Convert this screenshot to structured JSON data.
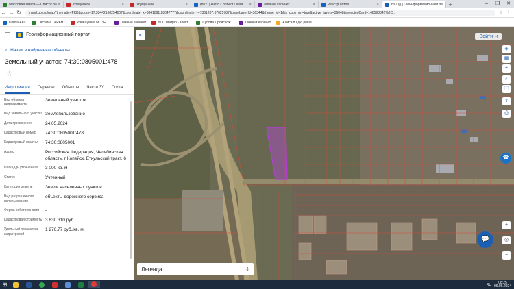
{
  "browser": {
    "tabs": [
      {
        "title": "Массовая земля — Список ра",
        "color": "#2e7d32",
        "active": false
      },
      {
        "title": "Упущенное",
        "color": "#c62828",
        "active": false
      },
      {
        "title": "Упущенное",
        "color": "#c62828",
        "active": false
      },
      {
        "title": "(8021) Retro Connect Client",
        "color": "#1565c0",
        "active": false
      },
      {
        "title": "Личный кабинет",
        "color": "#6a1b9a",
        "active": false
      },
      {
        "title": "Реестр лотов",
        "color": "#1565c0",
        "active": false
      },
      {
        "title": "НСПД | Геоинформационный п",
        "color": "#1a5fb4",
        "active": true
      }
    ],
    "url": "nspd.gov.ru/map?thematic=PKK&zoom=17.33442160254207&coordinate_x=6841891.28047777&coordinate_y=7361207.67025787&baseLayerId=36344&theme_id=1&is_copy_url=true&active_layers=36048&selectedCard=148598842%2C...",
    "bookmarks": [
      {
        "label": "Почта АКС",
        "color": "#1565c0"
      },
      {
        "label": "Система ГАРАНТ",
        "color": "#2e7d32"
      },
      {
        "label": "Извещения МОЗЕ...",
        "color": "#c62828"
      },
      {
        "label": "Личный кабинет",
        "color": "#6a1b9a"
      },
      {
        "label": "УПС гандар - злект...",
        "color": "#c62828"
      },
      {
        "label": "Сусова Происхож...",
        "color": "#2e7d32"
      },
      {
        "label": "Личный кабинет",
        "color": "#6a1b9a"
      },
      {
        "label": "Алиса Ю дю реше...",
        "color": "#f9a825"
      }
    ]
  },
  "portal": {
    "title": "Геоинформационный портал",
    "back_link": "Назад в найденные объекты",
    "parcel_title": "Земельный участок: 74:30:0805001:478",
    "tabs": [
      "Информация",
      "Сервисы",
      "Объекты",
      "Части ЗУ",
      "Соста"
    ],
    "fields": [
      {
        "key": "Вид объекта недвижимости",
        "value": "Земельный участок"
      },
      {
        "key": "Вид земельного участка",
        "value": "Землепользование"
      },
      {
        "key": "Дата присвоения",
        "value": "24.05.2024"
      },
      {
        "key": "Кадастровый номер",
        "value": "74:30:0805001:478"
      },
      {
        "key": "Кадастровый квартал",
        "value": "74:30:0805001"
      },
      {
        "key": "Адрес",
        "value": "Российская Федерация, Челябинская область, г Копейск, Еткульский тракт, 6"
      },
      {
        "key": "Площадь уточненная",
        "value": "3 000 кв. м"
      },
      {
        "key": "Статус",
        "value": "Учтенный"
      },
      {
        "key": "Категория земель",
        "value": "Земли населенных пунктов"
      },
      {
        "key": "Вид разрешенного использования",
        "value": "объекты дорожного сервиса"
      },
      {
        "key": "Форма собственности",
        "value": "-"
      },
      {
        "key": "Кадастровая стоимость",
        "value": "3 830 310 руб."
      },
      {
        "key": "Удельный показатель кадастровой",
        "value": "1 276,77 руб./кв. м"
      }
    ]
  },
  "map": {
    "login_label": "Войти",
    "legend_label": "Легенда"
  },
  "taskbar": {
    "time": "08:25",
    "date": "06.06.2024",
    "lang": "RU"
  }
}
